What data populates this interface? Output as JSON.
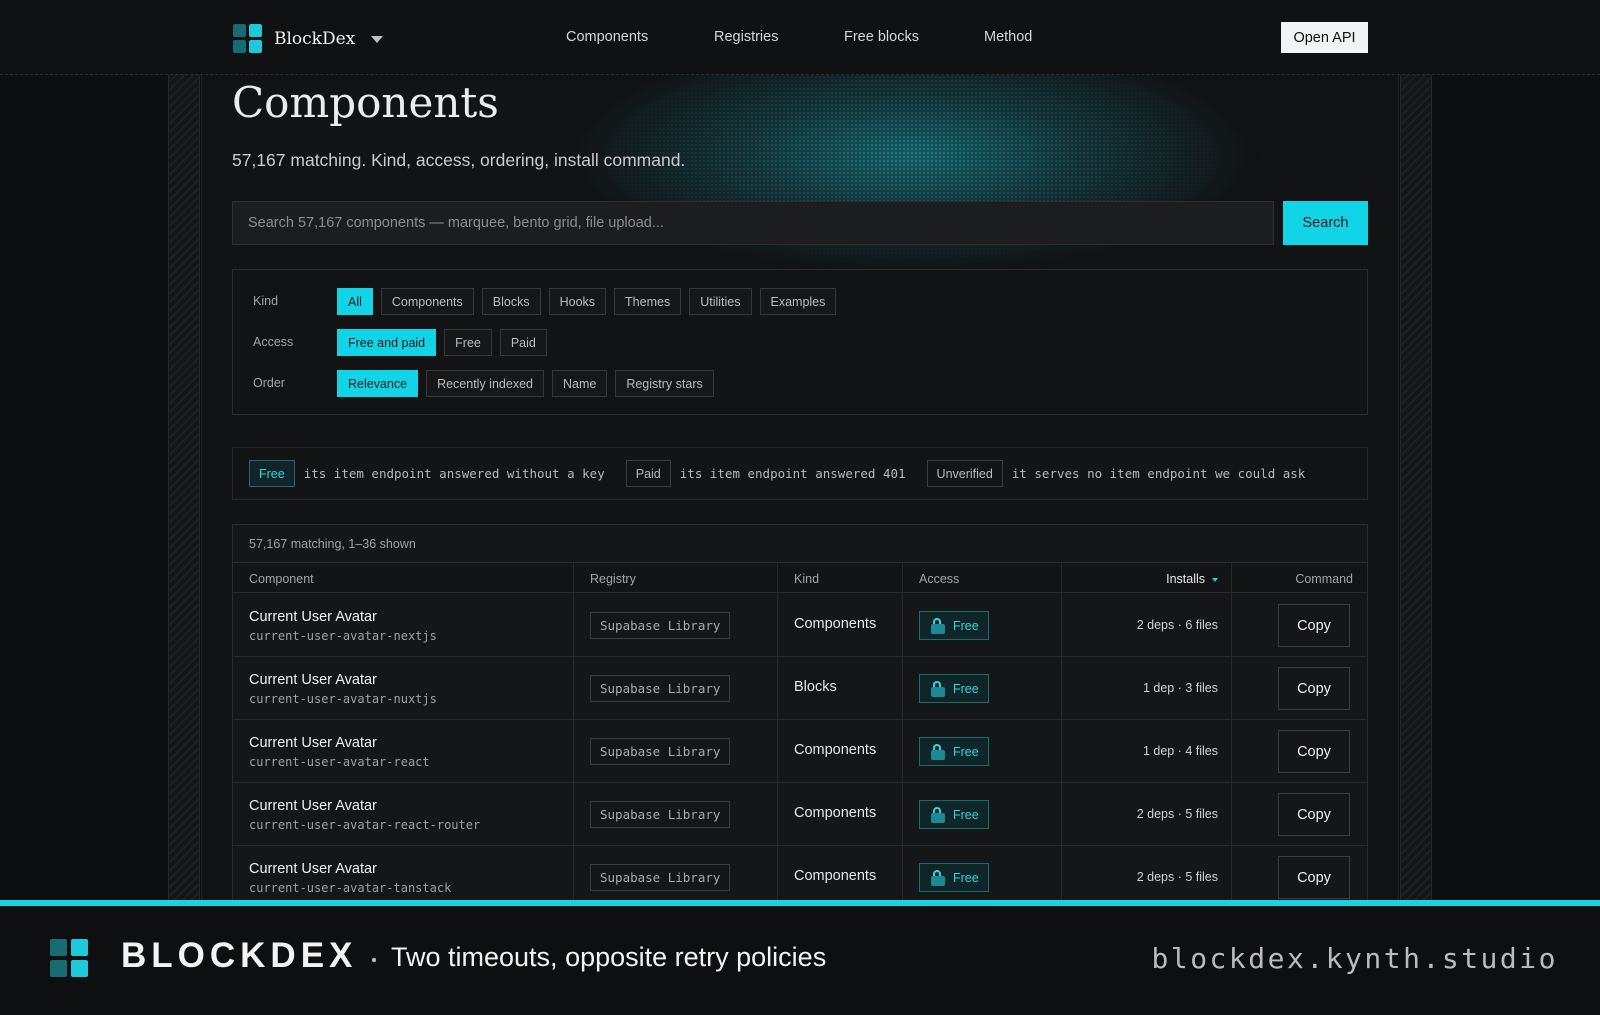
{
  "header": {
    "brand": "BlockDex",
    "nav": [
      "Components",
      "Registries",
      "Free blocks",
      "Method"
    ],
    "open_api_label": "Open API"
  },
  "page": {
    "title": "Components",
    "subtitle": "57,167 matching. Kind, access, ordering, install command."
  },
  "search": {
    "placeholder": "Search 57,167 components — marquee, bento grid, file upload...",
    "button_label": "Search"
  },
  "filters": {
    "kind": {
      "label": "Kind",
      "options": [
        "All",
        "Components",
        "Blocks",
        "Hooks",
        "Themes",
        "Utilities",
        "Examples"
      ],
      "selected": "All"
    },
    "access": {
      "label": "Access",
      "options": [
        "Free and paid",
        "Free",
        "Paid"
      ],
      "selected": "Free and paid"
    },
    "order": {
      "label": "Order",
      "options": [
        "Relevance",
        "Recently indexed",
        "Name",
        "Registry stars"
      ],
      "selected": "Relevance"
    }
  },
  "legend": [
    {
      "badge": "Free",
      "text": "its item endpoint answered without a key"
    },
    {
      "badge": "Paid",
      "text": "its item endpoint answered 401"
    },
    {
      "badge": "Unverified",
      "text": "it serves no item endpoint we could ask"
    }
  ],
  "table": {
    "count_text": "57,167 matching, 1–36 shown",
    "columns": [
      "Component",
      "Registry",
      "Kind",
      "Access",
      "Installs",
      "Command"
    ],
    "rows": [
      {
        "name": "Current User Avatar",
        "slug": "current-user-avatar-nextjs",
        "registry": "Supabase Library",
        "kind": "Components",
        "access": "Free",
        "installs": "2 deps · 6 files",
        "command": "Copy"
      },
      {
        "name": "Current User Avatar",
        "slug": "current-user-avatar-nuxtjs",
        "registry": "Supabase Library",
        "kind": "Blocks",
        "access": "Free",
        "installs": "1 dep · 3 files",
        "command": "Copy"
      },
      {
        "name": "Current User Avatar",
        "slug": "current-user-avatar-react",
        "registry": "Supabase Library",
        "kind": "Components",
        "access": "Free",
        "installs": "1 dep · 4 files",
        "command": "Copy"
      },
      {
        "name": "Current User Avatar",
        "slug": "current-user-avatar-react-router",
        "registry": "Supabase Library",
        "kind": "Components",
        "access": "Free",
        "installs": "2 deps · 5 files",
        "command": "Copy"
      },
      {
        "name": "Current User Avatar",
        "slug": "current-user-avatar-tanstack",
        "registry": "Supabase Library",
        "kind": "Components",
        "access": "Free",
        "installs": "2 deps · 5 files",
        "command": "Copy"
      }
    ]
  },
  "banner": {
    "name": "BLOCKDEX",
    "tagline": "Two timeouts, opposite retry policies",
    "url": "blockdex.kynth.studio"
  },
  "colors": {
    "accent": "#11d4e6",
    "logo_light": "#1ec9d9",
    "logo_dark": "#176b73",
    "background": "#0d0e0f"
  }
}
